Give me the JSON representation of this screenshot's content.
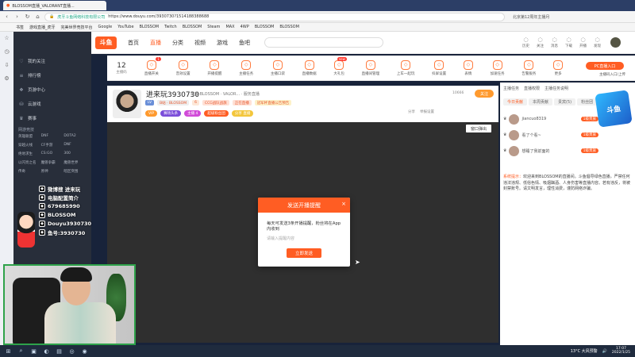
{
  "browser": {
    "tab_title": "BLOSSOM直播_VALORANT直播...",
    "url_label": "虎牙斗鱼网络科技有限公司",
    "url": "https://www.douyu.com/3930730?1514188388688",
    "top_right": "北京第12周年主播月",
    "bookmarks": [
      "书签",
      "游戏直播_虎牙",
      "完美世界竞技平台",
      "Google",
      "YouTube",
      "BLOSSOM",
      "Twitch",
      "BLOSSOM",
      "Steam",
      "MAX",
      "4WP",
      "BLOSSOM",
      "BLOSSOM"
    ],
    "side_icons": [
      "star-icon",
      "history-icon",
      "download-icon",
      "settings-icon"
    ]
  },
  "leftnav": {
    "items": [
      {
        "icon": "heart-icon",
        "label": "我的关注"
      },
      {
        "icon": "list-icon",
        "label": "排行榜"
      },
      {
        "icon": "gift-icon",
        "label": "页游中心"
      },
      {
        "icon": "cart-icon",
        "label": "云游戏"
      },
      {
        "icon": "trophy-icon",
        "label": "赛事"
      }
    ],
    "section": "网游竞技",
    "games": [
      "英雄联盟",
      "DNF",
      "DOTA2",
      "穿越火线",
      "CF手游",
      "DNF",
      "绝地求生",
      "CS:GO",
      "300",
      "以闪亮之名",
      "魔兽争霸",
      "魔兽世界",
      "传奇",
      "原神",
      "暗区突围"
    ]
  },
  "topnav": {
    "menu": [
      "首页",
      "直播",
      "分类",
      "视频",
      "游戏",
      "鱼吧"
    ],
    "active": "直播",
    "icons": [
      "历史",
      "关注",
      "消息",
      "下载",
      "开播",
      "发现"
    ]
  },
  "categories": {
    "count": "12",
    "count_label": "主播码",
    "items": [
      {
        "label": "直播开关",
        "badge": "1"
      },
      {
        "label": "音效设置",
        "badge": ""
      },
      {
        "label": "开播提醒",
        "badge": ""
      },
      {
        "label": "主播任务",
        "badge": ""
      },
      {
        "label": "主播口袋",
        "badge": ""
      },
      {
        "label": "直播数据",
        "badge": ""
      },
      {
        "label": "大礼包",
        "badge": "new"
      },
      {
        "label": "直播间管理",
        "badge": ""
      },
      {
        "label": "上车一起玩",
        "badge": ""
      },
      {
        "label": "抖屏设置",
        "badge": ""
      },
      {
        "label": "表情",
        "badge": ""
      },
      {
        "label": "加速任务",
        "badge": ""
      },
      {
        "label": "告警服务",
        "badge": ""
      },
      {
        "label": "更多",
        "badge": ""
      }
    ],
    "pc_button": "PC直播入口",
    "pc_sub": "主播码入口/上传"
  },
  "anchor": {
    "name": "进来玩3930730",
    "meta": "举报  BLOSSOM · VALOR...  · 服务直播",
    "tags": [
      "LV",
      "B站 · BLOSSOM",
      "6",
      "CCG战队战旗",
      "正在直播",
      "冠军杯直播公告预告"
    ],
    "fans": "185.6k",
    "subscribe": "关注",
    "sub_count": "10666",
    "pills": [
      "VIP",
      "赛场头条",
      "主播 4",
      "超级粉丝团",
      "分享 直播"
    ],
    "report": [
      "分享",
      "举报设置"
    ],
    "popout": "窗口弹出"
  },
  "modal": {
    "title": "发送开播提醒",
    "body": "每天可发送3条开播提醒，粉丝将在App内收到",
    "placeholder": "请输入提醒内容",
    "confirm": "立即发送"
  },
  "right": {
    "head": [
      "主播任务",
      "直播权限",
      "主播任务说明"
    ],
    "tabs": [
      "今日贡献",
      "本周贡献",
      "贵宾(5)",
      "粉丝团"
    ],
    "rank": [
      {
        "name": "jiancuo8319",
        "level": "1级贵族"
      },
      {
        "name": "看了个看~",
        "level": "1级贵族"
      },
      {
        "name": "想睡了我前面的",
        "level": "1级贵族"
      }
    ],
    "chat_sys": "系统提示：",
    "chat": "欢迎来到BLOSSOM的直播间。斗鱼倡导绿色直播，严禁任何违法违规、低俗色情、吸烟酗酒、人身伤害等直播内容。若有违反，将被封禁账号。请文明发言，理性消费，谨防网络诈骗。",
    "brand": "斗鱼"
  },
  "overlay": {
    "lines": [
      {
        "icon": "weibo-icon",
        "text": "微博搜 进来玩"
      },
      {
        "icon": "qq-icon",
        "text": "电脑配置简介"
      },
      {
        "icon": "qq-icon",
        "text": "679685990"
      },
      {
        "icon": "tiktok-icon",
        "text": "BLOSSOM"
      },
      {
        "icon": "tiktok-icon",
        "text": "Douyu3930730"
      },
      {
        "icon": "bili-icon",
        "text": "鱼号:3930730"
      }
    ]
  },
  "taskbar": {
    "weather": "13°C 大风预警",
    "time": "17:07",
    "date": "2022/1/25"
  }
}
